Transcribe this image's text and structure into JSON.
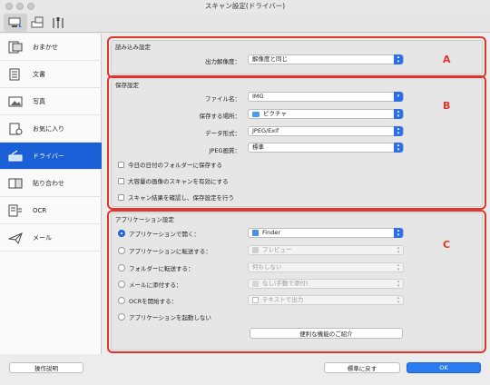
{
  "window": {
    "title": "スキャン設定(ドライバー)"
  },
  "sidebar": {
    "items": [
      {
        "label": "おまかせ"
      },
      {
        "label": "文書"
      },
      {
        "label": "写真"
      },
      {
        "label": "お気に入り"
      },
      {
        "label": "ドライバー"
      },
      {
        "label": "貼り合わせ"
      },
      {
        "label": "OCR"
      },
      {
        "label": "メール"
      }
    ]
  },
  "read_settings": {
    "title": "読み込み設定",
    "resolution_label": "出力解像度：",
    "resolution_value": "解像度と同じ"
  },
  "save_settings": {
    "title": "保存設定",
    "filename_label": "ファイル名：",
    "filename_value": "IMG",
    "location_label": "保存する場所：",
    "location_value": "ピクチャ",
    "format_label": "データ形式：",
    "format_value": "JPEG/Exif",
    "quality_label": "JPEG画質：",
    "quality_value": "標準",
    "check1": "今日の日付のフォルダーに保存する",
    "check2": "大容量の画像のスキャンを有効にする",
    "check3": "スキャン結果を確認し、保存設定を行う"
  },
  "app_settings": {
    "title": "アプリケーション設定",
    "r1": "アプリケーションで開く：",
    "r1_value": "Finder",
    "r2": "アプリケーションに転送する：",
    "r2_value": "プレビュー",
    "r3": "フォルダーに転送する：",
    "r3_value": "何もしない",
    "r4": "メールに添付する：",
    "r4_value": "なし(手動で添付)",
    "r5": "OCRを開始する：",
    "r5_value": "テキストで出力",
    "r6": "アプリケーションを起動しない",
    "features_button": "便利な機能のご紹介"
  },
  "annotations": {
    "a": "A",
    "b": "B",
    "c": "C"
  },
  "footer": {
    "help": "操作説明",
    "defaults": "標準に戻す",
    "ok": "OK"
  },
  "colors": {
    "accent": "#1b5fd6",
    "annotation": "#e0352b"
  }
}
